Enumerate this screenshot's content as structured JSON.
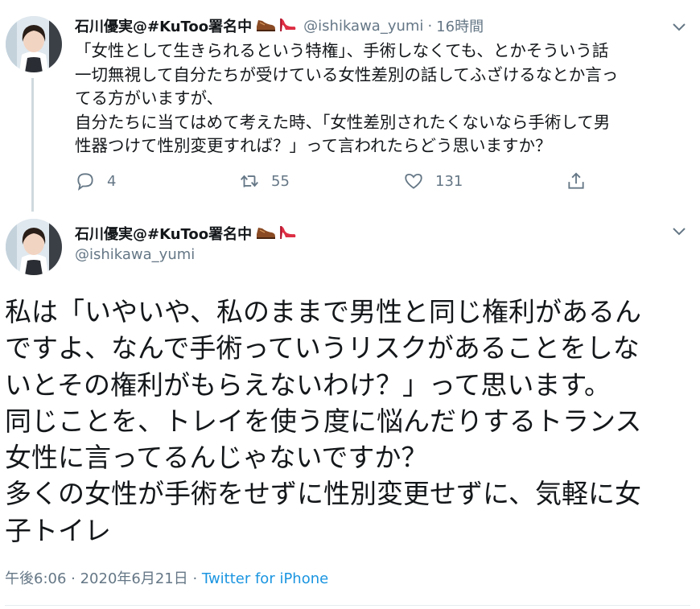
{
  "tweet1": {
    "display_name": "石川優実@#KuToo署名中",
    "handle": "@ishikawa_yumi",
    "separator": "·",
    "time": "16時間",
    "body_lines": [
      "「女性として生きられるという特権」、手術しなくても、とかそういう話",
      "一切無視して自分たちが受けている女性差別の話してふざけるなとか言っ",
      "てる方がいますが、",
      "自分たちに当てはめて考えた時、「女性差別されたくないなら手術して男",
      "性器つけて性別変更すれば？」って言われたらどう思いますか？"
    ],
    "actions": {
      "reply_count": "4",
      "retweet_count": "55",
      "like_count": "131"
    }
  },
  "tweet2": {
    "display_name": "石川優実@#KuToo署名中",
    "handle": "@ishikawa_yumi",
    "body_lines": [
      "私は「いやいや、私のままで男性と同じ権利があるん",
      "ですよ、なんで手術っていうリスクがあることをしな",
      "いとその権利がもらえないわけ？」って思います。",
      "同じことを、トレイを使う度に悩んだりするトランス",
      "女性に言ってるんじゃないですか？",
      "多くの女性が手術をせずに性別変更せずに、気軽に女",
      "子トイレ"
    ],
    "meta": {
      "timestamp": "午後6:06 · 2020年6月21日 · ",
      "source": "Twitter for iPhone"
    }
  },
  "icons": {
    "shoe": "brown-shoe-emoji",
    "heel": "red-high-heel-emoji",
    "reply": "reply-icon",
    "retweet": "retweet-icon",
    "like": "heart-icon",
    "share": "share-icon",
    "more": "chevron-down-icon"
  },
  "colors": {
    "text": "#14171a",
    "secondary": "#657786",
    "link": "#1b95e0",
    "thread_line": "#cfd9de"
  }
}
